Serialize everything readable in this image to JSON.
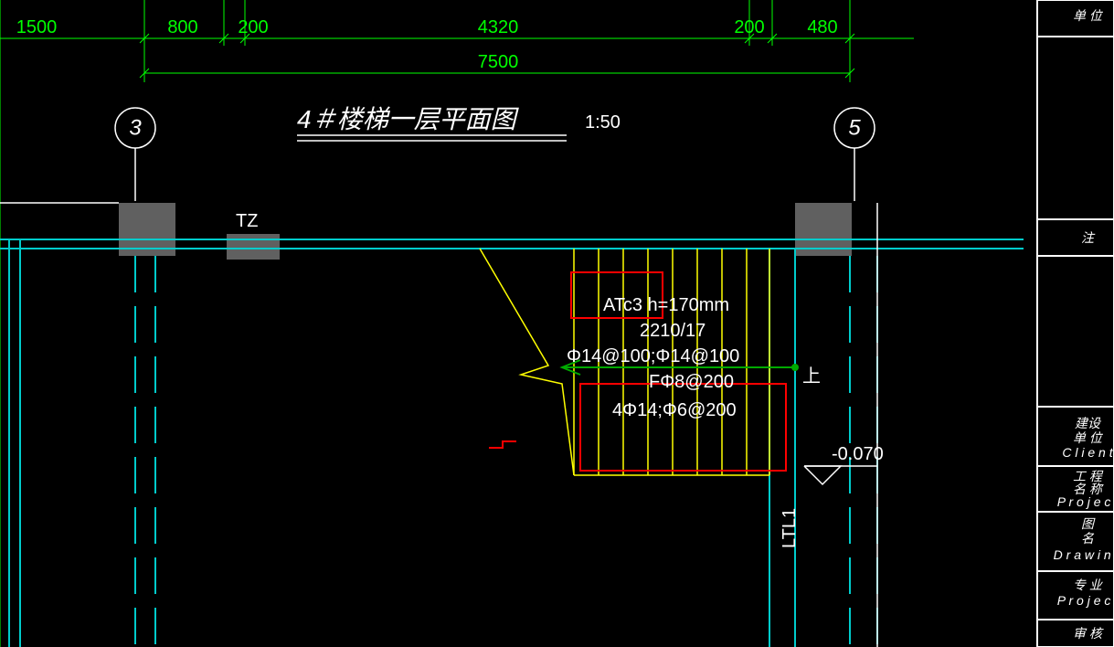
{
  "title": "4＃楼梯一层平面图",
  "scale": "1:50",
  "dimensions": {
    "row1": [
      "1500",
      "800",
      "200",
      "4320",
      "200",
      "480"
    ],
    "row2": "7500"
  },
  "grid_bubbles": {
    "left": "3",
    "right": "5"
  },
  "labels": {
    "tz": "TZ",
    "ltl1": "LTL1",
    "elev": "-0.070",
    "up_arrow_text": "上"
  },
  "stair_notes": [
    "ATc3  h=170mm",
    "2210/17",
    "Φ14@100;Φ14@100",
    "FΦ8@200",
    "4Φ14;Φ6@200"
  ],
  "titleblock": {
    "rows": [
      "单 位",
      "注",
      "建设\n单 位\nC l i e n t",
      "工 程\n名 称\nP r o j e c t",
      "图\n名\nD r a w i n g",
      "专 业\nP r o j e c t",
      "审 核"
    ]
  }
}
